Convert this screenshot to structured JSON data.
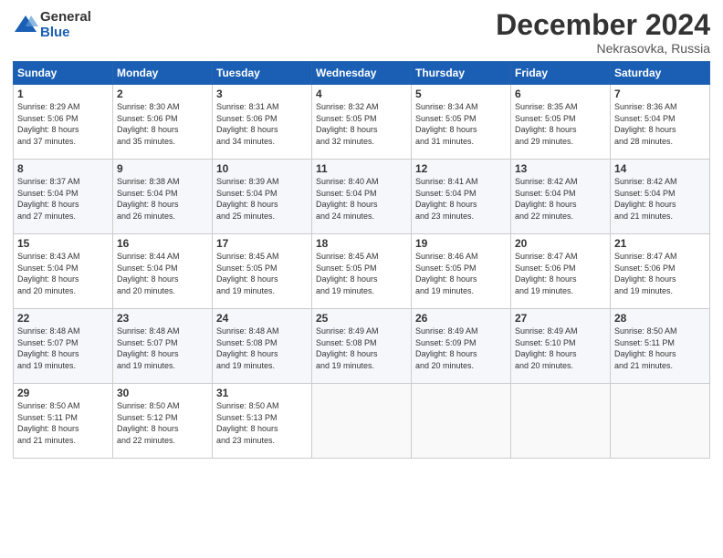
{
  "header": {
    "logo_line1": "General",
    "logo_line2": "Blue",
    "month": "December 2024",
    "location": "Nekrasovka, Russia"
  },
  "weekdays": [
    "Sunday",
    "Monday",
    "Tuesday",
    "Wednesday",
    "Thursday",
    "Friday",
    "Saturday"
  ],
  "weeks": [
    [
      {
        "day": "1",
        "info": "Sunrise: 8:29 AM\nSunset: 5:06 PM\nDaylight: 8 hours\nand 37 minutes."
      },
      {
        "day": "2",
        "info": "Sunrise: 8:30 AM\nSunset: 5:06 PM\nDaylight: 8 hours\nand 35 minutes."
      },
      {
        "day": "3",
        "info": "Sunrise: 8:31 AM\nSunset: 5:06 PM\nDaylight: 8 hours\nand 34 minutes."
      },
      {
        "day": "4",
        "info": "Sunrise: 8:32 AM\nSunset: 5:05 PM\nDaylight: 8 hours\nand 32 minutes."
      },
      {
        "day": "5",
        "info": "Sunrise: 8:34 AM\nSunset: 5:05 PM\nDaylight: 8 hours\nand 31 minutes."
      },
      {
        "day": "6",
        "info": "Sunrise: 8:35 AM\nSunset: 5:05 PM\nDaylight: 8 hours\nand 29 minutes."
      },
      {
        "day": "7",
        "info": "Sunrise: 8:36 AM\nSunset: 5:04 PM\nDaylight: 8 hours\nand 28 minutes."
      }
    ],
    [
      {
        "day": "8",
        "info": "Sunrise: 8:37 AM\nSunset: 5:04 PM\nDaylight: 8 hours\nand 27 minutes."
      },
      {
        "day": "9",
        "info": "Sunrise: 8:38 AM\nSunset: 5:04 PM\nDaylight: 8 hours\nand 26 minutes."
      },
      {
        "day": "10",
        "info": "Sunrise: 8:39 AM\nSunset: 5:04 PM\nDaylight: 8 hours\nand 25 minutes."
      },
      {
        "day": "11",
        "info": "Sunrise: 8:40 AM\nSunset: 5:04 PM\nDaylight: 8 hours\nand 24 minutes."
      },
      {
        "day": "12",
        "info": "Sunrise: 8:41 AM\nSunset: 5:04 PM\nDaylight: 8 hours\nand 23 minutes."
      },
      {
        "day": "13",
        "info": "Sunrise: 8:42 AM\nSunset: 5:04 PM\nDaylight: 8 hours\nand 22 minutes."
      },
      {
        "day": "14",
        "info": "Sunrise: 8:42 AM\nSunset: 5:04 PM\nDaylight: 8 hours\nand 21 minutes."
      }
    ],
    [
      {
        "day": "15",
        "info": "Sunrise: 8:43 AM\nSunset: 5:04 PM\nDaylight: 8 hours\nand 20 minutes."
      },
      {
        "day": "16",
        "info": "Sunrise: 8:44 AM\nSunset: 5:04 PM\nDaylight: 8 hours\nand 20 minutes."
      },
      {
        "day": "17",
        "info": "Sunrise: 8:45 AM\nSunset: 5:05 PM\nDaylight: 8 hours\nand 19 minutes."
      },
      {
        "day": "18",
        "info": "Sunrise: 8:45 AM\nSunset: 5:05 PM\nDaylight: 8 hours\nand 19 minutes."
      },
      {
        "day": "19",
        "info": "Sunrise: 8:46 AM\nSunset: 5:05 PM\nDaylight: 8 hours\nand 19 minutes."
      },
      {
        "day": "20",
        "info": "Sunrise: 8:47 AM\nSunset: 5:06 PM\nDaylight: 8 hours\nand 19 minutes."
      },
      {
        "day": "21",
        "info": "Sunrise: 8:47 AM\nSunset: 5:06 PM\nDaylight: 8 hours\nand 19 minutes."
      }
    ],
    [
      {
        "day": "22",
        "info": "Sunrise: 8:48 AM\nSunset: 5:07 PM\nDaylight: 8 hours\nand 19 minutes."
      },
      {
        "day": "23",
        "info": "Sunrise: 8:48 AM\nSunset: 5:07 PM\nDaylight: 8 hours\nand 19 minutes."
      },
      {
        "day": "24",
        "info": "Sunrise: 8:48 AM\nSunset: 5:08 PM\nDaylight: 8 hours\nand 19 minutes."
      },
      {
        "day": "25",
        "info": "Sunrise: 8:49 AM\nSunset: 5:08 PM\nDaylight: 8 hours\nand 19 minutes."
      },
      {
        "day": "26",
        "info": "Sunrise: 8:49 AM\nSunset: 5:09 PM\nDaylight: 8 hours\nand 20 minutes."
      },
      {
        "day": "27",
        "info": "Sunrise: 8:49 AM\nSunset: 5:10 PM\nDaylight: 8 hours\nand 20 minutes."
      },
      {
        "day": "28",
        "info": "Sunrise: 8:50 AM\nSunset: 5:11 PM\nDaylight: 8 hours\nand 21 minutes."
      }
    ],
    [
      {
        "day": "29",
        "info": "Sunrise: 8:50 AM\nSunset: 5:11 PM\nDaylight: 8 hours\nand 21 minutes."
      },
      {
        "day": "30",
        "info": "Sunrise: 8:50 AM\nSunset: 5:12 PM\nDaylight: 8 hours\nand 22 minutes."
      },
      {
        "day": "31",
        "info": "Sunrise: 8:50 AM\nSunset: 5:13 PM\nDaylight: 8 hours\nand 23 minutes."
      },
      null,
      null,
      null,
      null
    ]
  ]
}
